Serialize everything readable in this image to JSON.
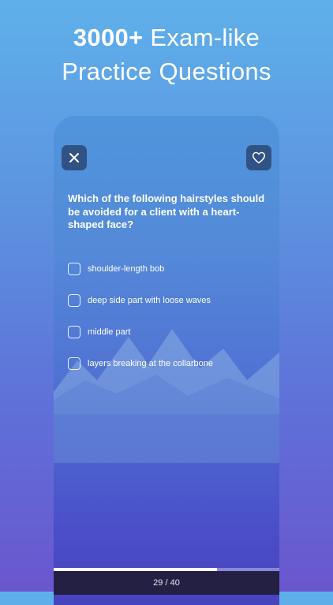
{
  "headline": {
    "bold": "3000+",
    "rest_line1": "Exam-like",
    "line2": "Practice Questions"
  },
  "question": {
    "text": "Which of the following hairstyles should be avoided for a client with a  heart-shaped face?",
    "options": [
      {
        "label": "shoulder-length bob"
      },
      {
        "label": "deep side part with loose waves"
      },
      {
        "label": "middle part"
      },
      {
        "label": "layers breaking at the collarbone"
      }
    ]
  },
  "progress": {
    "text": "29 / 40",
    "current": 29,
    "total": 40,
    "fraction": 0.725
  },
  "colors": {
    "background_top": "#5fb0ea",
    "background_bottom": "#6a56cf",
    "footer": "#232044",
    "button": "#263a62"
  },
  "icons": {
    "close": "close-icon",
    "favorite": "heart-icon"
  }
}
